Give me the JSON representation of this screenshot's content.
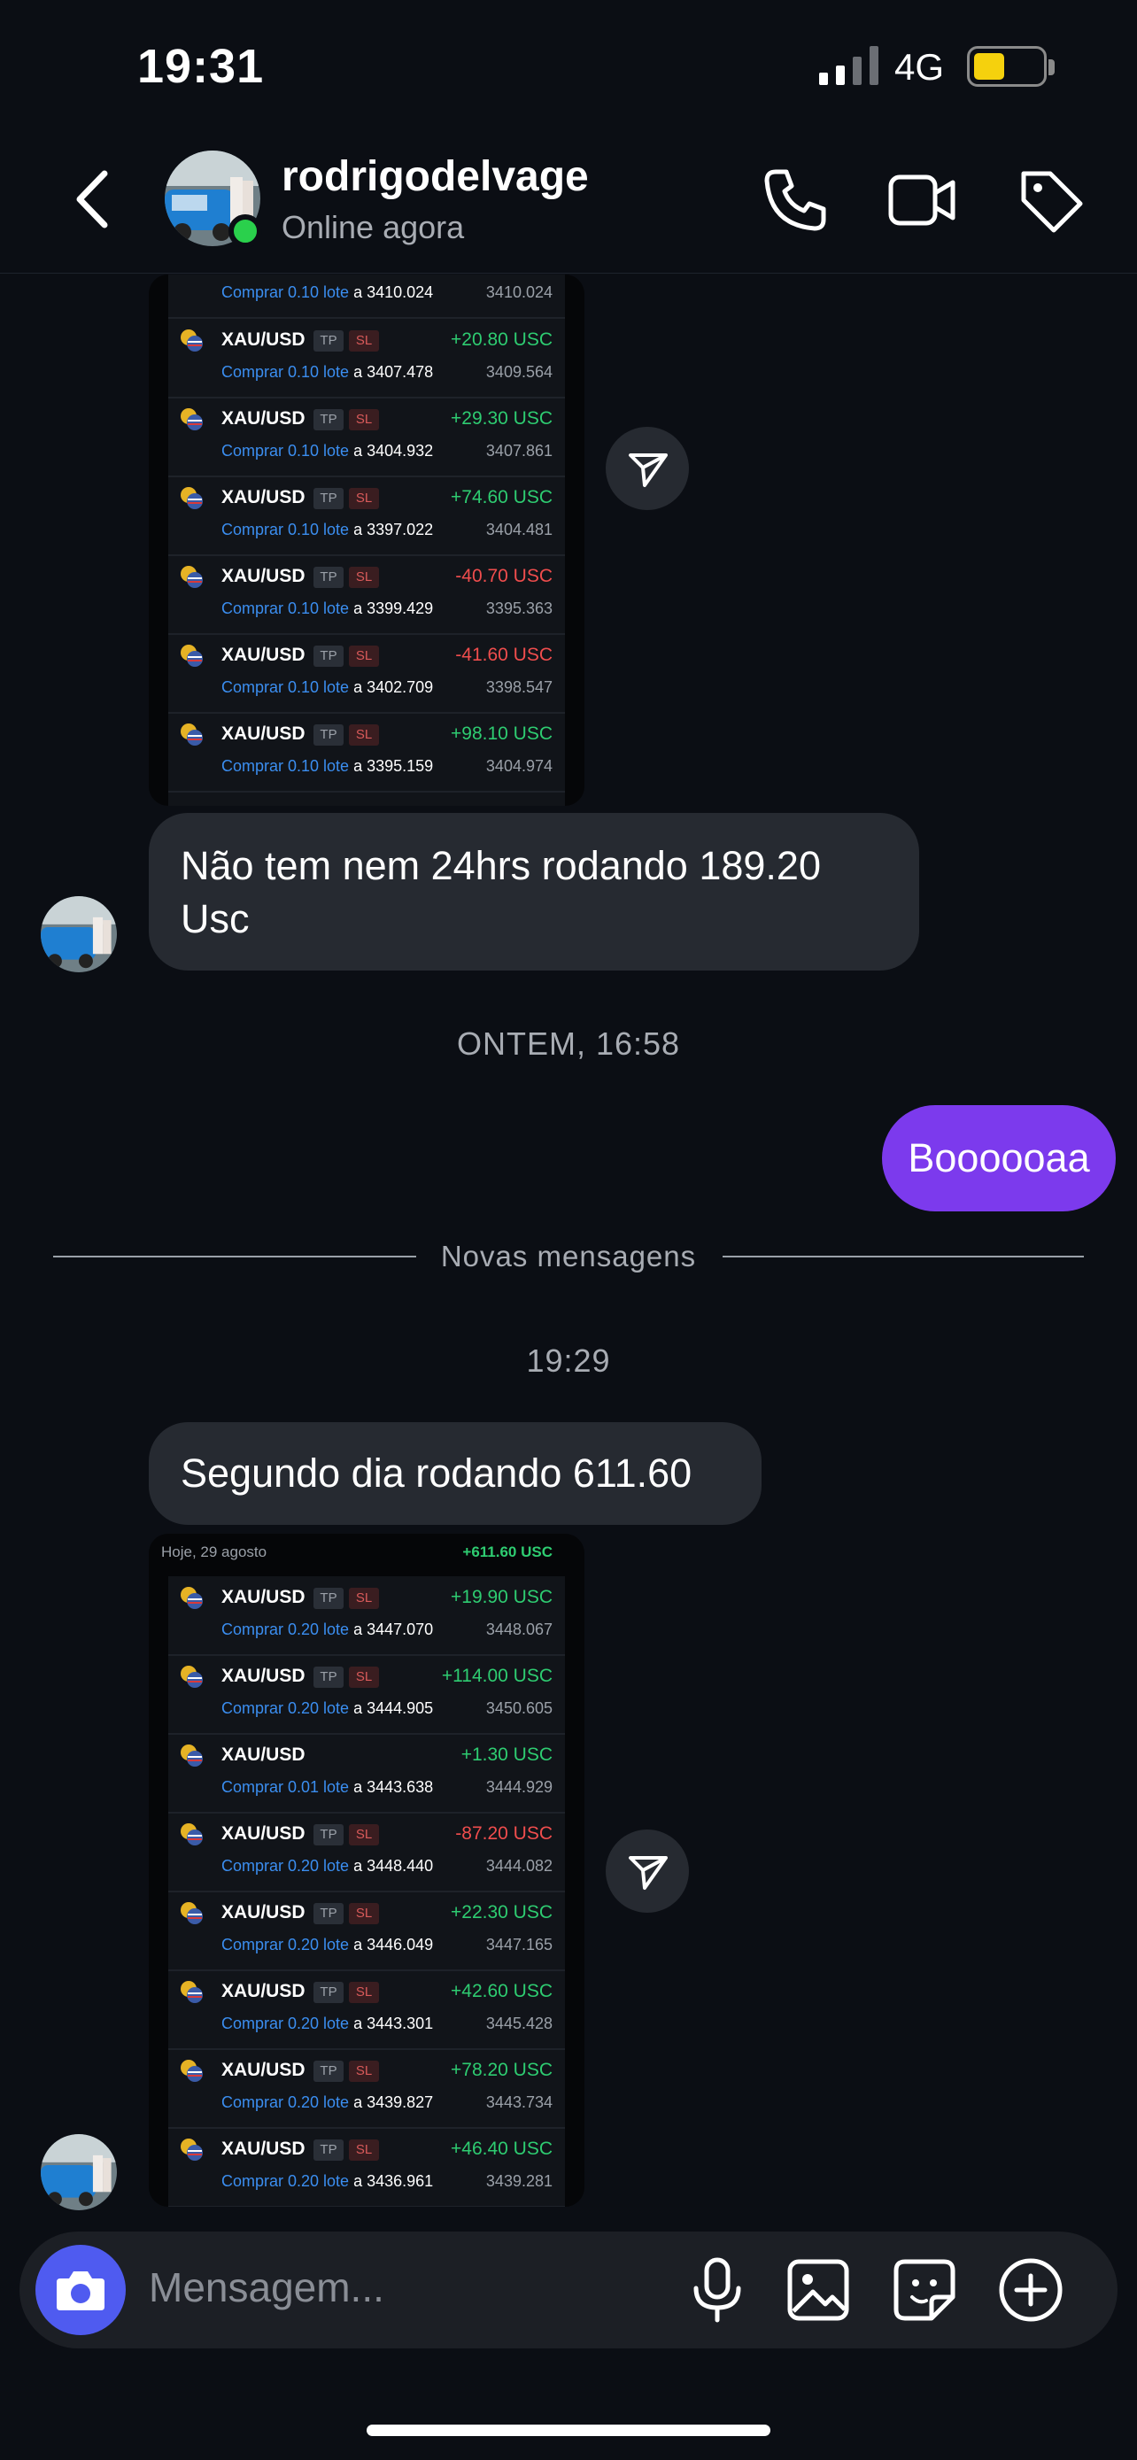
{
  "status_bar": {
    "time": "19:31",
    "network": "4G",
    "battery_level": 0.45,
    "battery_color": "#f5d10d"
  },
  "header": {
    "contact_name": "rodrigodelvage",
    "status": "Online agora",
    "icons": [
      "back-chevron-icon",
      "phone-icon",
      "video-icon",
      "tag-icon"
    ]
  },
  "trades_1": [
    {
      "symbol": "XAU/USD",
      "tp": "TP",
      "sl": "SL",
      "pnl": "+20.80 USC",
      "side": "Comprar 0.10 lote",
      "open": "a 3407.478",
      "current": "3409.564"
    },
    {
      "symbol": "XAU/USD",
      "tp": "TP",
      "sl": "SL",
      "pnl": "+29.30 USC",
      "side": "Comprar 0.10 lote",
      "open": "a 3404.932",
      "current": "3407.861"
    },
    {
      "symbol": "XAU/USD",
      "tp": "TP",
      "sl": "SL",
      "pnl": "+74.60 USC",
      "side": "Comprar 0.10 lote",
      "open": "a 3397.022",
      "current": "3404.481"
    },
    {
      "symbol": "XAU/USD",
      "tp": "TP",
      "sl": "SL",
      "pnl": "-40.70 USC",
      "side": "Comprar 0.10 lote",
      "open": "a 3399.429",
      "current": "3395.363"
    },
    {
      "symbol": "XAU/USD",
      "tp": "TP",
      "sl": "SL",
      "pnl": "-41.60 USC",
      "side": "Comprar 0.10 lote",
      "open": "a 3402.709",
      "current": "3398.547"
    },
    {
      "symbol": "XAU/USD",
      "tp": "TP",
      "sl": "SL",
      "pnl": "+98.10 USC",
      "side": "Comprar 0.10 lote",
      "open": "a 3395.159",
      "current": "3404.974"
    }
  ],
  "trades_1_partial": {
    "side": "Comprar 0.10 lote",
    "open": "a 3410.024",
    "current": "3410.024"
  },
  "messages": {
    "msg1": "Não tem nem 24hrs rodando 189.20 Usc",
    "timestamp1": "ONTEM, 16:58",
    "msg2_out": "Boooooaa",
    "divider": "Novas mensagens",
    "timestamp2": "19:29",
    "msg3": "Segundo dia rodando 611.60"
  },
  "shot2_header": {
    "date": "Hoje, 29 agosto",
    "total": "+611.60 USC"
  },
  "trades_2": [
    {
      "symbol": "XAU/USD",
      "tp": "TP",
      "sl": "SL",
      "pnl": "+19.90 USC",
      "side": "Comprar 0.20 lote",
      "open": "a 3447.070",
      "current": "3448.067"
    },
    {
      "symbol": "XAU/USD",
      "tp": "TP",
      "sl": "SL",
      "pnl": "+114.00 USC",
      "side": "Comprar 0.20 lote",
      "open": "a 3444.905",
      "current": "3450.605"
    },
    {
      "symbol": "XAU/USD",
      "tp": "",
      "sl": "",
      "pnl": "+1.30 USC",
      "side": "Comprar 0.01 lote",
      "open": "a 3443.638",
      "current": "3444.929"
    },
    {
      "symbol": "XAU/USD",
      "tp": "TP",
      "sl": "SL",
      "pnl": "-87.20 USC",
      "side": "Comprar 0.20 lote",
      "open": "a 3448.440",
      "current": "3444.082"
    },
    {
      "symbol": "XAU/USD",
      "tp": "TP",
      "sl": "SL",
      "pnl": "+22.30 USC",
      "side": "Comprar 0.20 lote",
      "open": "a 3446.049",
      "current": "3447.165"
    },
    {
      "symbol": "XAU/USD",
      "tp": "TP",
      "sl": "SL",
      "pnl": "+42.60 USC",
      "side": "Comprar 0.20 lote",
      "open": "a 3443.301",
      "current": "3445.428"
    },
    {
      "symbol": "XAU/USD",
      "tp": "TP",
      "sl": "SL",
      "pnl": "+78.20 USC",
      "side": "Comprar 0.20 lote",
      "open": "a 3439.827",
      "current": "3443.734"
    },
    {
      "symbol": "XAU/USD",
      "tp": "TP",
      "sl": "SL",
      "pnl": "+46.40 USC",
      "side": "Comprar 0.20 lote",
      "open": "a 3436.961",
      "current": "3439.281"
    }
  ],
  "composer": {
    "placeholder": "Mensagem...",
    "icons": [
      "camera-icon",
      "microphone-icon",
      "gallery-icon",
      "sticker-icon",
      "plus-icon"
    ]
  },
  "colors": {
    "accent_purple": "#7c3aed",
    "camera_blue": "#4f5bf0",
    "profit": "#2ecc71",
    "loss": "#ef4d4d",
    "online": "#2ad04c"
  }
}
